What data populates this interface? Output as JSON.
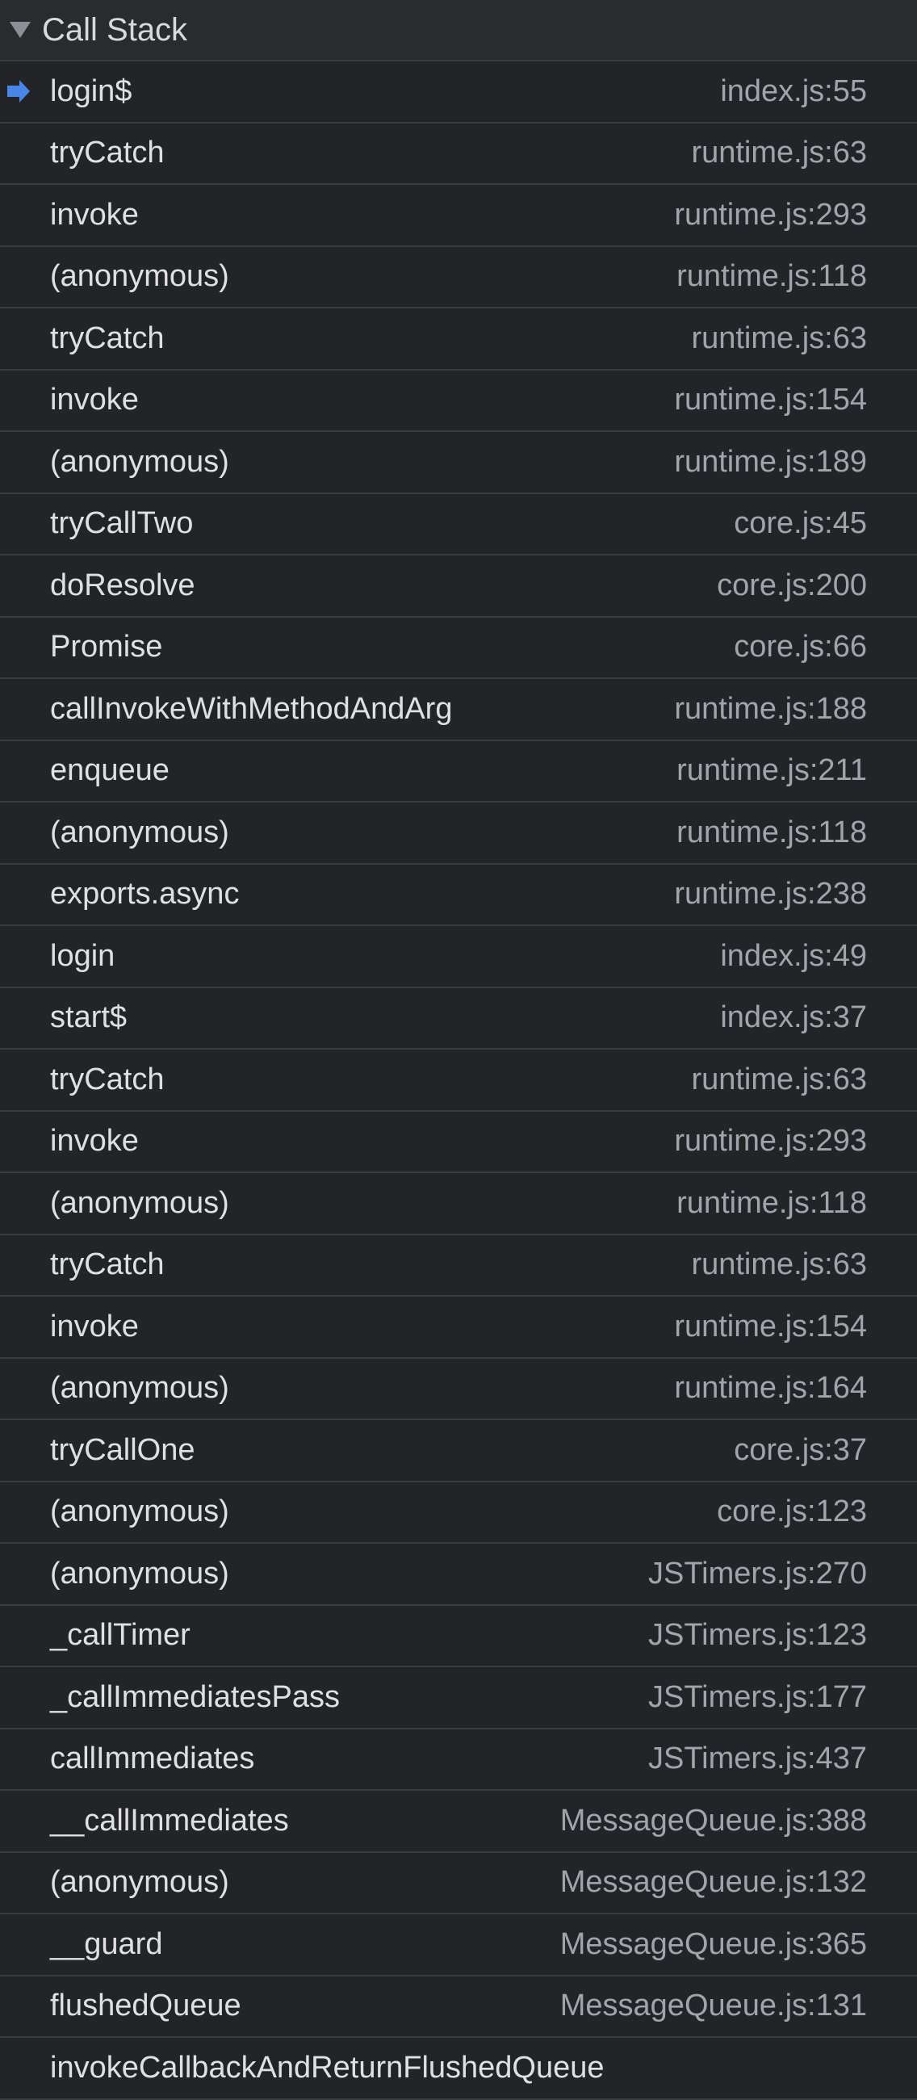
{
  "panel": {
    "title": "Call Stack",
    "expanded": true,
    "colors": {
      "background": "#232427",
      "header_background": "#2a2b2e",
      "separator": "#3a3b3f",
      "name_text": "#e0e0e3",
      "location_text": "#a3a4a9",
      "current_frame_marker": "#4a86e8"
    }
  },
  "frames": [
    {
      "name": "login$",
      "location": "index.js:55",
      "current": true
    },
    {
      "name": "tryCatch",
      "location": "runtime.js:63"
    },
    {
      "name": "invoke",
      "location": "runtime.js:293"
    },
    {
      "name": "(anonymous)",
      "location": "runtime.js:118"
    },
    {
      "name": "tryCatch",
      "location": "runtime.js:63"
    },
    {
      "name": "invoke",
      "location": "runtime.js:154"
    },
    {
      "name": "(anonymous)",
      "location": "runtime.js:189"
    },
    {
      "name": "tryCallTwo",
      "location": "core.js:45"
    },
    {
      "name": "doResolve",
      "location": "core.js:200"
    },
    {
      "name": "Promise",
      "location": "core.js:66"
    },
    {
      "name": "callInvokeWithMethodAndArg",
      "location": "runtime.js:188"
    },
    {
      "name": "enqueue",
      "location": "runtime.js:211"
    },
    {
      "name": "(anonymous)",
      "location": "runtime.js:118"
    },
    {
      "name": "exports.async",
      "location": "runtime.js:238"
    },
    {
      "name": "login",
      "location": "index.js:49"
    },
    {
      "name": "start$",
      "location": "index.js:37"
    },
    {
      "name": "tryCatch",
      "location": "runtime.js:63"
    },
    {
      "name": "invoke",
      "location": "runtime.js:293"
    },
    {
      "name": "(anonymous)",
      "location": "runtime.js:118"
    },
    {
      "name": "tryCatch",
      "location": "runtime.js:63"
    },
    {
      "name": "invoke",
      "location": "runtime.js:154"
    },
    {
      "name": "(anonymous)",
      "location": "runtime.js:164"
    },
    {
      "name": "tryCallOne",
      "location": "core.js:37"
    },
    {
      "name": "(anonymous)",
      "location": "core.js:123"
    },
    {
      "name": "(anonymous)",
      "location": "JSTimers.js:270"
    },
    {
      "name": "_callTimer",
      "location": "JSTimers.js:123"
    },
    {
      "name": "_callImmediatesPass",
      "location": "JSTimers.js:177"
    },
    {
      "name": "callImmediates",
      "location": "JSTimers.js:437"
    },
    {
      "name": "__callImmediates",
      "location": "MessageQueue.js:388"
    },
    {
      "name": "(anonymous)",
      "location": "MessageQueue.js:132"
    },
    {
      "name": "__guard",
      "location": "MessageQueue.js:365"
    },
    {
      "name": "flushedQueue",
      "location": "MessageQueue.js:131"
    },
    {
      "name": "invokeCallbackAndReturnFlushedQueue",
      "location": ""
    }
  ]
}
